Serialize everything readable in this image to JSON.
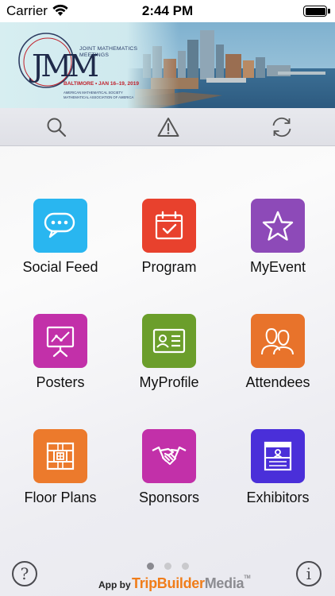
{
  "status_bar": {
    "carrier": "Carrier",
    "time": "2:44 PM"
  },
  "banner": {
    "logo_monogram": "JMM",
    "logo_title": "JOINT MATHEMATICS MEETINGS",
    "logo_location": "BALTIMORE • JAN 16–19, 2019",
    "logo_society_1": "AMERICAN MATHEMATICAL SOCIETY",
    "logo_society_2": "MATHEMATICAL ASSOCIATION OF AMERICA"
  },
  "toolbar": {
    "search_icon": "search-icon",
    "alert_icon": "alert-icon",
    "sync_icon": "sync-icon"
  },
  "tiles": [
    {
      "label": "Social Feed",
      "icon": "chat-bubbles-icon",
      "color": "#29b6f0"
    },
    {
      "label": "Program",
      "icon": "calendar-check-icon",
      "color": "#e8412d"
    },
    {
      "label": "MyEvent",
      "icon": "star-icon",
      "color": "#8d4ab8"
    },
    {
      "label": "Posters",
      "icon": "presentation-board-icon",
      "color": "#c230a9"
    },
    {
      "label": "MyProfile",
      "icon": "id-card-icon",
      "color": "#6b9e2b"
    },
    {
      "label": "Attendees",
      "icon": "people-icon",
      "color": "#e8732b"
    },
    {
      "label": "Floor Plans",
      "icon": "floor-plan-icon",
      "color": "#ec7a2c"
    },
    {
      "label": "Sponsors",
      "icon": "handshake-icon",
      "color": "#c230a9"
    },
    {
      "label": "Exhibitors",
      "icon": "booth-icon",
      "color": "#4a2fd9"
    }
  ],
  "pager": {
    "pages": 3,
    "current": 1
  },
  "footer": {
    "help_symbol": "?",
    "info_symbol": "i",
    "app_by": "App by",
    "brand_trip": "TripBuilder",
    "brand_media": "Media",
    "brand_tm": "TM"
  }
}
